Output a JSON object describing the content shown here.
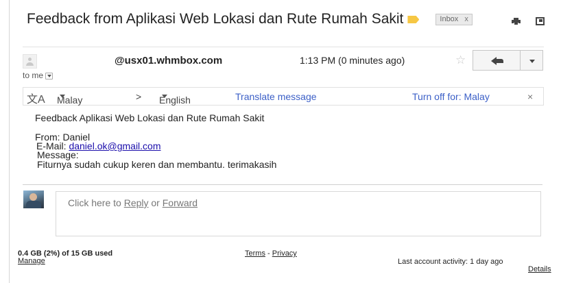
{
  "subject": {
    "text": "Feedback from Aplikasi Web Lokasi dan Rute Rumah Sakit",
    "label_color": "#f6c744",
    "label_chip": "Inbox",
    "label_chip_close": "x"
  },
  "header_icons": {
    "print": "print-icon",
    "popout": "new-window-icon"
  },
  "message": {
    "sender": "@usx01.whmbox.com",
    "time": "1:13 PM (0 minutes ago)",
    "star": "☆",
    "recipient": "to me",
    "reply_icon": "reply-arrow-icon",
    "more_icon": "chevron-down-icon"
  },
  "translate": {
    "icon": "文A",
    "source_lang": "Malay",
    "arrow": ">",
    "target_lang": "English",
    "action": "Translate message",
    "turn_off": "Turn off for: Malay",
    "close": "×"
  },
  "body": {
    "line1": "Feedback Aplikasi Web Lokasi dan Rute Rumah Sakit",
    "from": "From: Daniel",
    "email_label": "E-Mail:",
    "email": "daniel.ok@gmail.com",
    "message_label": "Message:",
    "message_text": "Fiturnya sudah cukup keren dan membantu. terimakasih"
  },
  "reply_box": {
    "prefix": "Click here to",
    "reply": "Reply",
    "or": "or",
    "forward": "Forward"
  },
  "footer": {
    "storage": "0.4 GB (2%) of 15 GB used",
    "manage": "Manage",
    "terms": "Terms",
    "separator": "-",
    "privacy": "Privacy",
    "last_activity": "Last account activity: 1 day ago",
    "details": "Details"
  }
}
